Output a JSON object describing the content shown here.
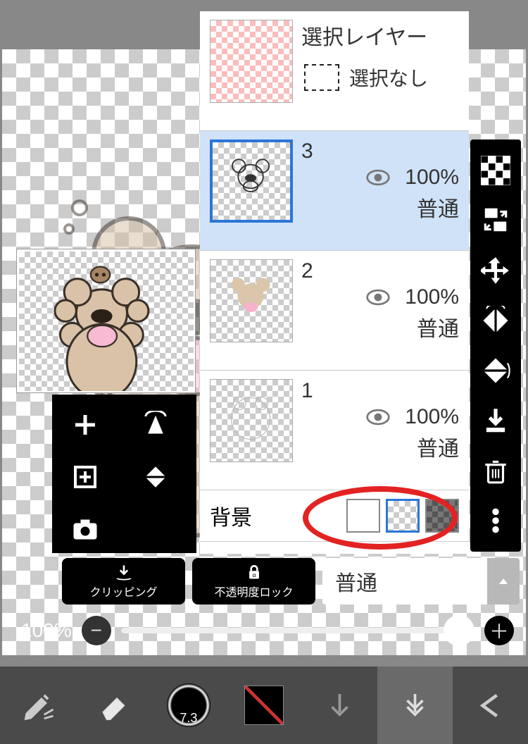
{
  "selection_layer": {
    "title": "選択レイヤー",
    "status": "選択なし"
  },
  "layers": [
    {
      "name": "3",
      "opacity": "100%",
      "blend": "普通",
      "visible": true,
      "selected": true
    },
    {
      "name": "2",
      "opacity": "100%",
      "blend": "普通",
      "visible": true,
      "selected": false
    },
    {
      "name": "1",
      "opacity": "100%",
      "blend": "普通",
      "visible": true,
      "selected": false
    }
  ],
  "background": {
    "label": "背景",
    "selected": "transparent"
  },
  "clipping_button": "クリッピング",
  "alpha_lock_button": "不透明度ロック",
  "blend_mode": "普通",
  "opacity_value": "100%",
  "brush_size": "7.3",
  "side_tools": [
    "checker-icon",
    "transform-icon",
    "move-icon",
    "flip-horizontal-icon",
    "flip-vertical-icon",
    "merge-down-icon",
    "trash-icon",
    "more-icon"
  ],
  "mini_tools": [
    "add",
    "flip-h",
    "duplicate",
    "flip-v",
    "camera"
  ],
  "bottom_tools": [
    "brush-edit",
    "eraser",
    "brush",
    "color",
    "download",
    "layers",
    "back"
  ]
}
